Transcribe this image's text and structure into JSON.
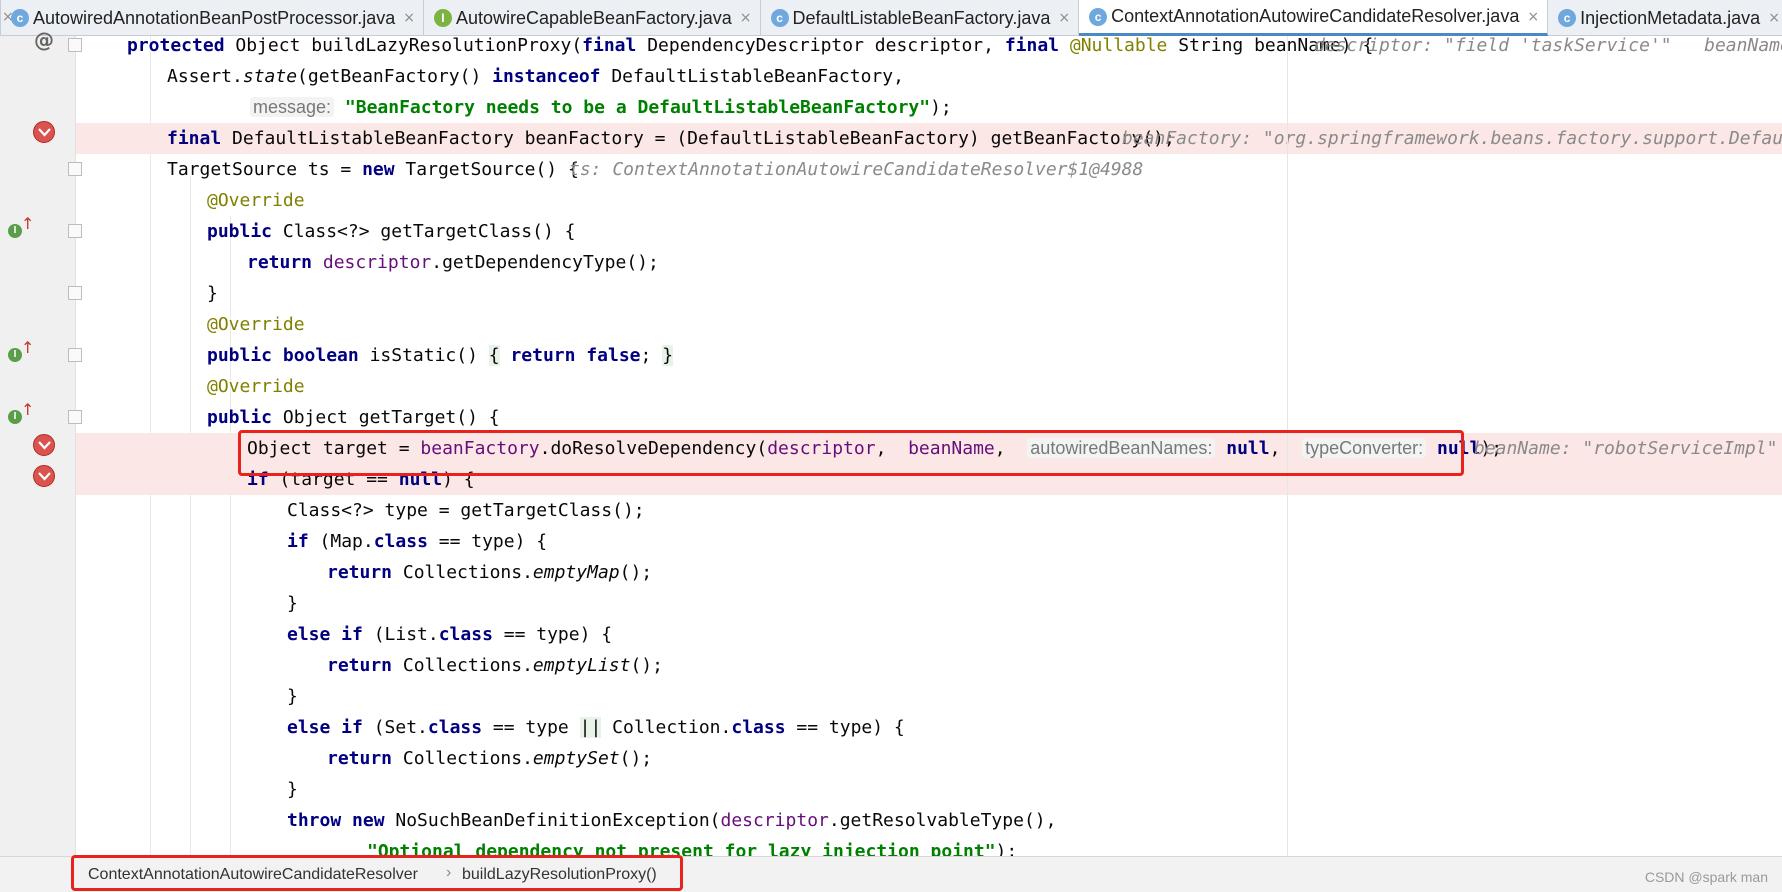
{
  "tabs": [
    {
      "label": "AutowiredAnnotationBeanPostProcessor.java",
      "kind": "class",
      "icon_letter": "c"
    },
    {
      "label": "AutowireCapableBeanFactory.java",
      "kind": "interface",
      "icon_letter": "I"
    },
    {
      "label": "DefaultListableBeanFactory.java",
      "kind": "class",
      "icon_letter": "c"
    },
    {
      "label": "ContextAnnotationAutowireCandidateResolver.java",
      "kind": "class",
      "icon_letter": "c",
      "active": true
    },
    {
      "label": "InjectionMetadata.java",
      "kind": "class",
      "icon_letter": "c"
    }
  ],
  "close_glyph": "×",
  "code": {
    "l1_kw1": "protected",
    "l1_rest": " Object buildLazyResolutionProxy(",
    "l1_kw2": "final",
    "l1_mid": " DependencyDescriptor descriptor, ",
    "l1_kw3": "final",
    "l1_ann": " @Nullable",
    "l1_end": " String beanName) {",
    "l1_inlay": "descriptor: \"field 'taskService'\"   beanName: \"r",
    "l2_a": "Assert.",
    "l2_b": "state",
    "l2_c": "(getBeanFactory() ",
    "l2_kw": "instanceof",
    "l2_d": " DefaultListableBeanFactory,",
    "l3_hint": "message:",
    "l3_str": "\"BeanFactory needs to be a DefaultListableBeanFactory\"",
    "l3_end": ");",
    "l4_kw": "final",
    "l4_rest": " DefaultListableBeanFactory beanFactory = (DefaultListableBeanFactory) getBeanFactory();",
    "l4_inlay": "beanFactory: \"org.springframework.beans.factory.support.DefaultLis",
    "l5_a": "TargetSource ts = ",
    "l5_kw": "new",
    "l5_b": " TargetSource() {",
    "l5_inlay": "ts: ContextAnnotationAutowireCandidateResolver$1@4988",
    "override": "@Override",
    "l7_kw": "public",
    "l7_rest": " Class<?> getTargetClass() {",
    "l8_kw": "return",
    "l8_fld": " descriptor",
    "l8_rest": ".getDependencyType();",
    "close_brace": "}",
    "l11_kw1": "public",
    "l11_kw2": " boolean",
    "l11_rest": " isStatic() ",
    "l11_ob": "{",
    "l11_kw3": " return false",
    "l11_semi": "; ",
    "l11_cb": "}",
    "l13_kw": "public",
    "l13_rest": " Object getTarget() {",
    "l14_a": "Object target = ",
    "l14_fld1": "beanFactory",
    "l14_b": ".doResolveDependency(",
    "l14_fld2": "descriptor",
    "l14_c": ",  ",
    "l14_fld3": "beanName",
    "l14_d": ",  ",
    "l14_hint1": "autowiredBeanNames:",
    "l14_null1": " null",
    "l14_e": ",  ",
    "l14_hint2": "typeConverter:",
    "l14_null2": " null",
    "l14_end": ");",
    "l14_inlay": "beanName: \"robotServiceImpl\"",
    "l15_kw": "if",
    "l15_rest": " (target == ",
    "l15_null": "null",
    "l15_end": ") {",
    "l16": "Class<?> type = getTargetClass();",
    "l17_kw": "if",
    "l17_a": " (Map.",
    "l17_cls": "class",
    "l17_b": " == type) {",
    "l18_kw": "return",
    "l18_a": " Collections.",
    "l18_m": "emptyMap",
    "l18_b": "();",
    "l20_kw": "else if",
    "l20_a": " (List.",
    "l20_cls": "class",
    "l20_b": " == type) {",
    "l21_kw": "return",
    "l21_a": " Collections.",
    "l21_m": "emptyList",
    "l21_b": "();",
    "l23_kw": "else if",
    "l23_a": " (Set.",
    "l23_cls": "class",
    "l23_b": " == type ",
    "l23_or": "||",
    "l23_c": " Collection.",
    "l23_cls2": "class",
    "l23_d": " == type) {",
    "l24_kw": "return",
    "l24_a": " Collections.",
    "l24_m": "emptySet",
    "l24_b": "();",
    "l26_kw1": "throw",
    "l26_kw2": " new",
    "l26_a": " NoSuchBeanDefinitionException(",
    "l26_fld": "descriptor",
    "l26_b": ".getResolvableType(),",
    "l27_str": "\"Optional dependency not present for lazy injection point\"",
    "l27_end": ");"
  },
  "breadcrumb": {
    "class_name": "ContextAnnotationAutowireCandidateResolver",
    "separator": "›",
    "method_name": "buildLazyResolutionProxy()"
  },
  "watermark": "CSDN @spark man",
  "gutter": {
    "at_symbol": "@",
    "impl_letter": "I",
    "impl_arrow": "↑"
  },
  "colors": {
    "keyword": "#000080",
    "annotation": "#808000",
    "string": "#008000",
    "field": "#660e7a",
    "error_line": "#fbe7e6",
    "highlight_box": "#e8231f"
  }
}
